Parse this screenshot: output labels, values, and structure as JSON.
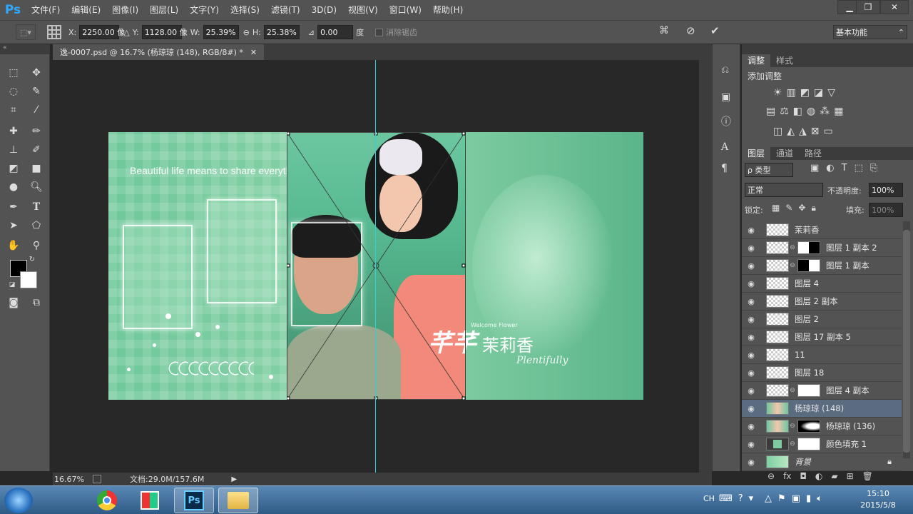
{
  "app": {
    "logo": "Ps"
  },
  "menu": [
    "文件(F)",
    "编辑(E)",
    "图像(I)",
    "图层(L)",
    "文字(Y)",
    "选择(S)",
    "滤镜(T)",
    "3D(D)",
    "视图(V)",
    "窗口(W)",
    "帮助(H)"
  ],
  "options": {
    "x_label": "X:",
    "x_value": "2250.00 像",
    "y_label": "Y:",
    "y_value": "1128.00 像",
    "w_label": "W:",
    "w_value": "25.39%",
    "h_label": "H:",
    "h_value": "25.38%",
    "angle_value": "0.00",
    "angle_unit": "度",
    "antialias_label": "消除锯齿",
    "workspace": "基本功能"
  },
  "document": {
    "tab_title": "逸-0007.psd @ 16.7% (杨琼琼 (148), RGB/8#) *",
    "tagline": "Beautiful life means to share everything with you",
    "logo_text": "芊芊",
    "logo_name": "茉莉香",
    "logo_small": "Plentifully",
    "logo_tiny": "Welcome Flower"
  },
  "status": {
    "zoom": "16.67%",
    "doc_info": "文档:29.0M/157.6M"
  },
  "adjust_panel": {
    "tabs": [
      "调整",
      "样式"
    ],
    "heading": "添加调整"
  },
  "layers_panel": {
    "tabs": [
      "图层",
      "通道",
      "路径"
    ],
    "filter_label": "ρ 类型",
    "blend_mode": "正常",
    "opacity_label": "不透明度:",
    "opacity_value": "100%",
    "lock_label": "锁定:",
    "fill_label": "填充:",
    "fill_value": "100%",
    "layers": [
      {
        "name": "茉莉香",
        "mask": false,
        "selected": false
      },
      {
        "name": "图层 1 副本 2",
        "mask": true,
        "selected": false
      },
      {
        "name": "图层 1 副本",
        "mask": true,
        "selected": false
      },
      {
        "name": "图层 4",
        "mask": false,
        "selected": false
      },
      {
        "name": "图层 2 副本",
        "mask": false,
        "selected": false
      },
      {
        "name": "图层 2",
        "mask": false,
        "selected": false
      },
      {
        "name": "图层 17 副本 5",
        "mask": false,
        "selected": false
      },
      {
        "name": "11",
        "mask": false,
        "selected": false
      },
      {
        "name": "图层 18",
        "mask": false,
        "selected": false
      },
      {
        "name": "图层 4 副本",
        "mask": true,
        "selected": false
      },
      {
        "name": "杨琼琼 (148)",
        "mask": false,
        "selected": true
      },
      {
        "name": "杨琼琼 (136)",
        "mask": true,
        "selected": false
      },
      {
        "name": "颜色填充 1",
        "mask": true,
        "selected": false
      },
      {
        "name": "背景",
        "mask": false,
        "selected": false,
        "locked": true
      }
    ]
  },
  "taskbar": {
    "ime": "CH",
    "time": "15:10",
    "date": "2015/5/8"
  }
}
